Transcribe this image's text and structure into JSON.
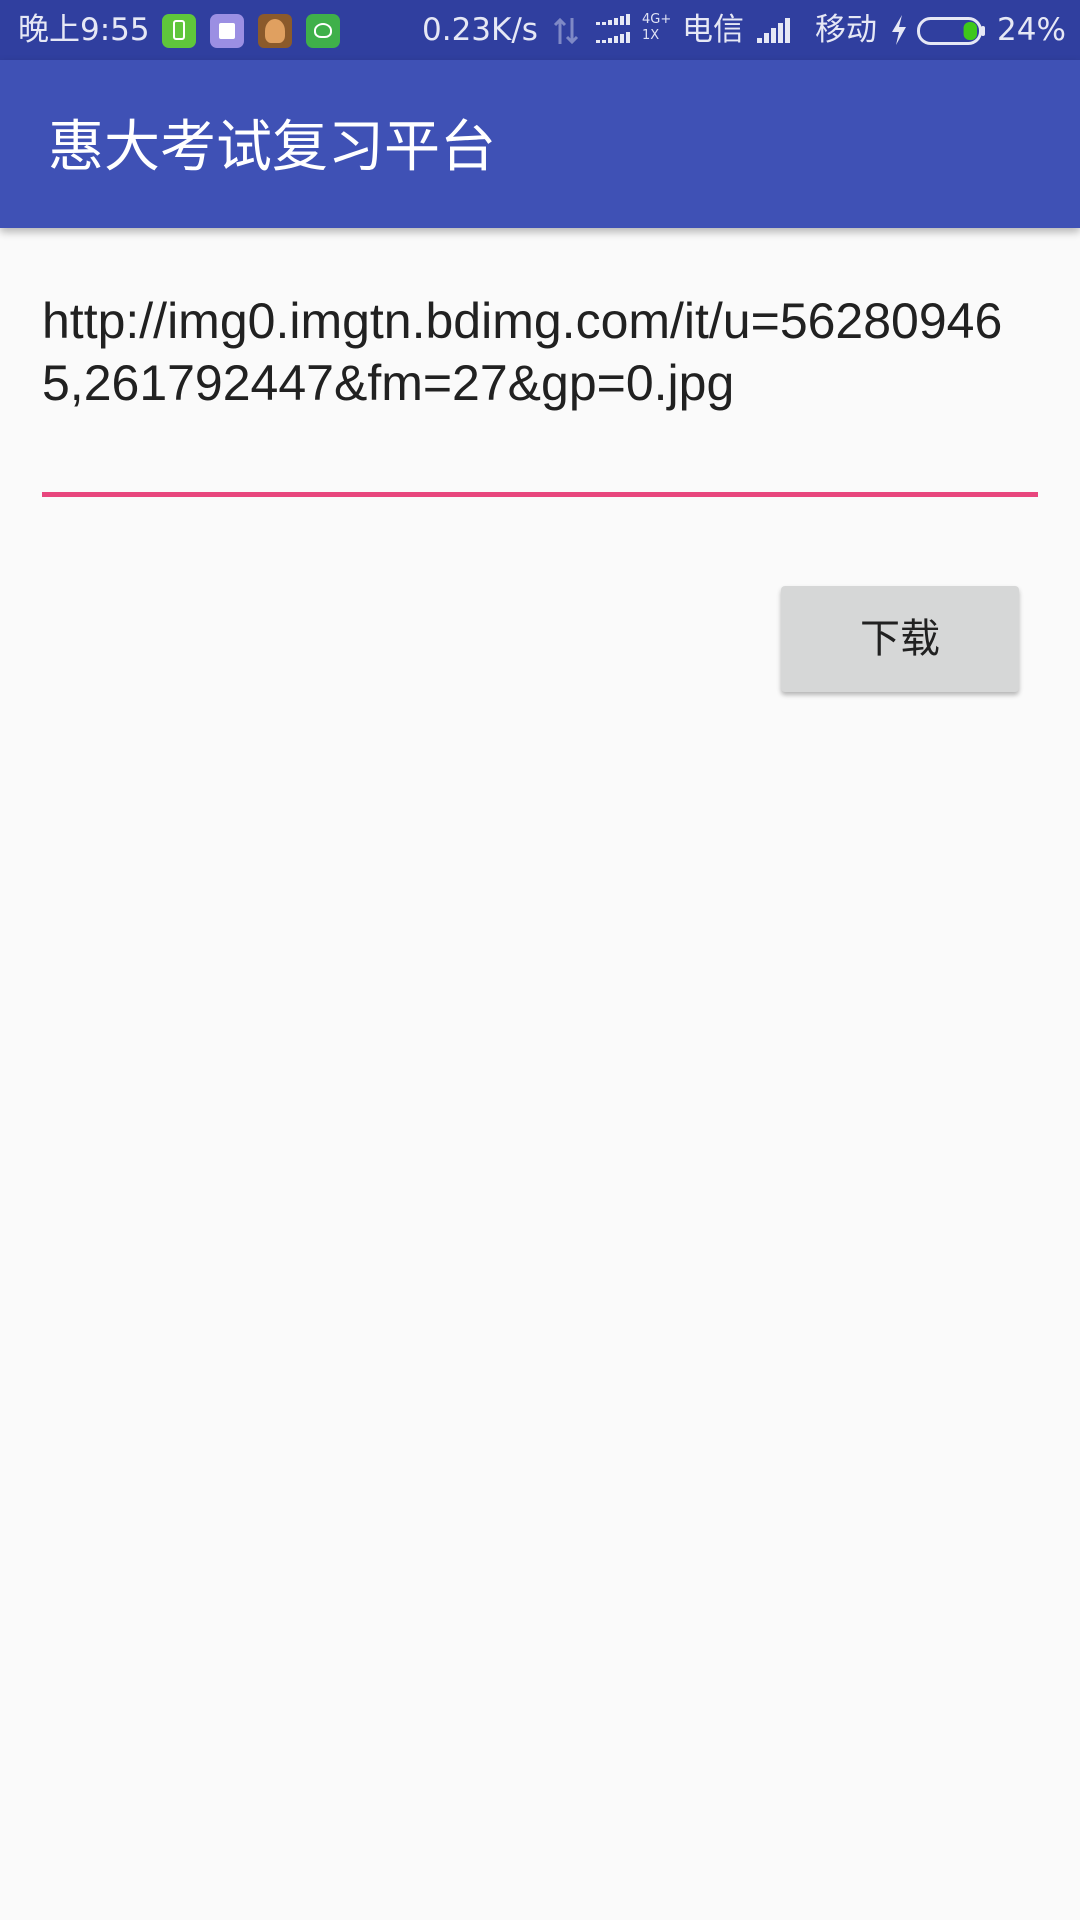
{
  "status_bar": {
    "time": "晚上9:55",
    "network_speed": "0.23K/s",
    "network_type_top": "4G+",
    "network_type_bottom": "1X",
    "carrier_1": "电信",
    "carrier_2": "移动",
    "battery_percent": "24%",
    "battery_level": 0.24,
    "notification_icons": [
      "phone-manager-icon",
      "cards-app-icon",
      "game-avatar-icon",
      "android-app-icon"
    ]
  },
  "app_bar": {
    "title": "惠大考试复习平台",
    "color": "#3f51b5"
  },
  "url_input": {
    "value": "http://img0.imgtn.bdimg.com/it/u=562809465,261792447&fm=27&gp=0.jpg",
    "underline_color": "#e8467d"
  },
  "download_button": {
    "label": "下载"
  },
  "colors": {
    "status_bar": "#303f9f",
    "background": "#fafafa",
    "button": "#d6d7d7",
    "battery_fill": "#3ec71b"
  }
}
